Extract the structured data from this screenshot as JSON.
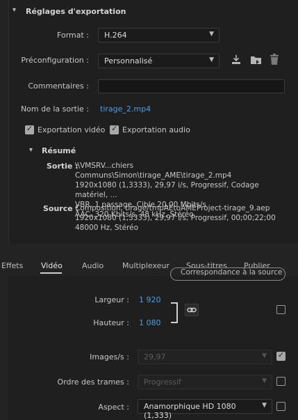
{
  "export_settings": {
    "section_title": "Réglages d'exportation",
    "format_label": "Format :",
    "format_value": "H.264",
    "preset_label": "Préconfiguration :",
    "preset_value": "Personnalisé",
    "comments_label": "Commentaires :",
    "comments_value": "",
    "output_label": "Nom de la sortie :",
    "output_value": "tirage_2.mp4",
    "export_video_label": "Exportation vidéo",
    "export_video_checked": true,
    "export_audio_label": "Exportation audio",
    "export_audio_checked": true
  },
  "summary": {
    "title": "Résumé",
    "output_label": "Sortie :",
    "output_lines": [
      "\\\\VMSRV...chiers Communs\\Simon\\tirage_AME\\tirage_2.mp4",
      "1920x1080 (1,3333), 29,97 i/s, Progressif, Codage matériel, ...",
      "VBR, 1 passage, Cible 20,00  Mbits/s",
      "AAC, 320  Kbits/s, 48 kHz, Stéréo"
    ],
    "source_label": "Source :",
    "source_lines": [
      "Composition, tirage/tmpAEtoAMEProject-tirage_9.aep",
      "1920x1080 (1,3333), 29,97 i/s, Progressif, 00;00;22;00",
      "48000 Hz, Stéréo"
    ]
  },
  "tabs": [
    {
      "label": "Effets",
      "active": false
    },
    {
      "label": "Vidéo",
      "active": true
    },
    {
      "label": "Audio",
      "active": false
    },
    {
      "label": "Multiplexeur",
      "active": false
    },
    {
      "label": "Sous-titres",
      "active": false
    },
    {
      "label": "Publier",
      "active": false
    }
  ],
  "video": {
    "match_source_label": "Correspondance à la source",
    "width_label": "Largeur :",
    "width_value": "1 920",
    "height_label": "Hauteur :",
    "height_value": "1 080",
    "link_checked": false,
    "fps_label": "Images/s :",
    "fps_value": "29,97",
    "fps_checked": true,
    "field_order_label": "Ordre des trames :",
    "field_order_value": "Progressif",
    "field_order_checked": false,
    "aspect_label": "Aspect :",
    "aspect_value": "Anamorphique HD 1080 (1,333)",
    "aspect_checked": false
  },
  "icons": [
    "chevron-down-icon",
    "import-preset-icon",
    "save-preset-icon",
    "delete-preset-icon",
    "link-icon"
  ],
  "colors": {
    "accent_link": "#4a9fe8",
    "background": "#232323",
    "panel": "#1f1f1f"
  }
}
